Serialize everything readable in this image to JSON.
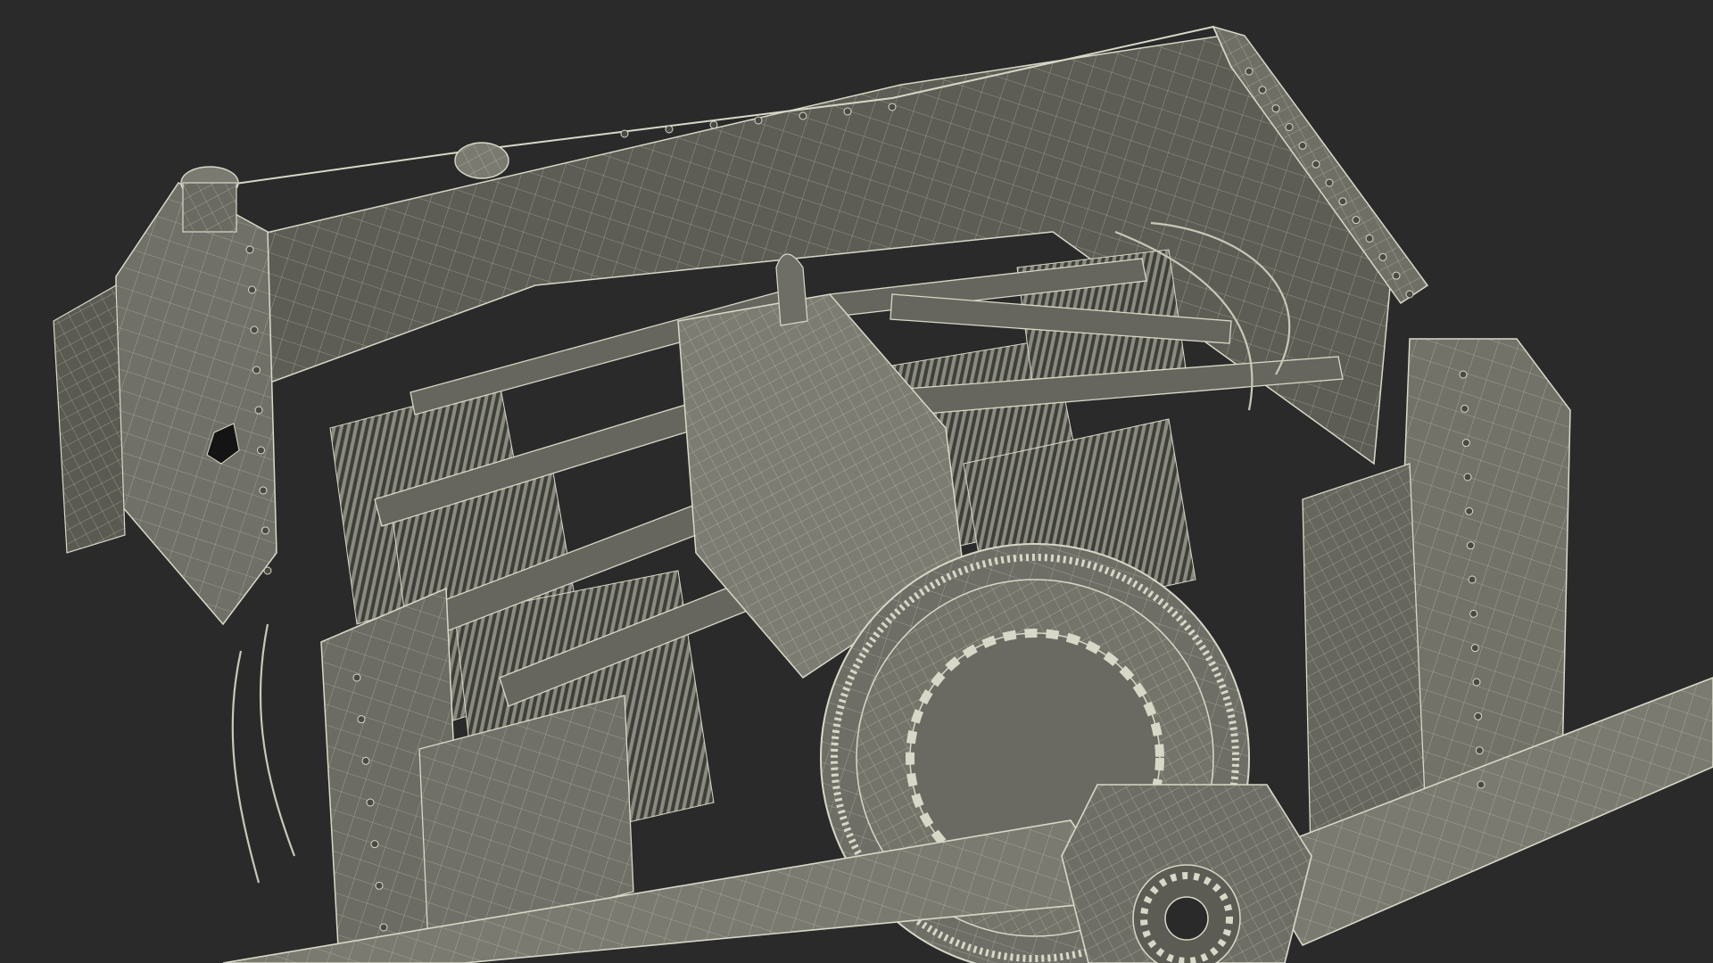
{
  "scene": {
    "subject": "radial-engine-wireframe-render",
    "colors": {
      "background": "#2a2a2a",
      "surface": "#6f6f66",
      "surface_light": "#8a8a80",
      "surface_dark": "#4a4a44",
      "wire": "#d8d8c8",
      "shadow": "#1e1e1c"
    }
  }
}
